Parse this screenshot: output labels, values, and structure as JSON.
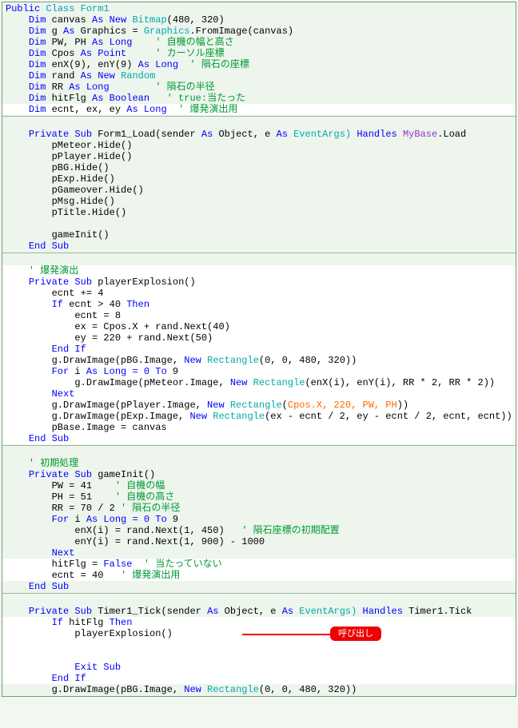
{
  "block1": {
    "l1_a": "Public",
    "l1_b": " Class ",
    "l1_c": "Form1",
    "l2_a": "    ",
    "l2_b": "Dim",
    "l2_c": " canvas ",
    "l2_d": "As",
    "l2_e": " New ",
    "l2_f": "Bitmap",
    "l2_g": "(480, 320)",
    "l3_a": "    ",
    "l3_b": "Dim",
    "l3_c": " g ",
    "l3_d": "As",
    "l3_e": " Graphics = ",
    "l3_f": "Graphics",
    "l3_g": ".FromImage(canvas)",
    "l4_a": "    ",
    "l4_b": "Dim",
    "l4_c": " PW, PH ",
    "l4_d": "As",
    "l4_e": " Long    ",
    "l4_f": "' 自機の幅と高さ",
    "l5_a": "    ",
    "l5_b": "Dim",
    "l5_c": " Cpos ",
    "l5_d": "As",
    "l5_e": " Point     ",
    "l5_f": "' カーソル座標",
    "l6_a": "    ",
    "l6_b": "Dim",
    "l6_c": " enX(9), enY(9) ",
    "l6_d": "As",
    "l6_e": " Long",
    "l6_f": "  ' 隕石の座標",
    "l7_a": "    ",
    "l7_b": "Dim",
    "l7_c": " rand ",
    "l7_d": "As",
    "l7_e": " New ",
    "l7_f": "Random",
    "l8_a": "    ",
    "l8_b": "Dim",
    "l8_c": " RR ",
    "l8_d": "As",
    "l8_e": " Long        ",
    "l8_f": "' 隕石の半径",
    "l9_a": "    ",
    "l9_b": "Dim",
    "l9_c": " hitFlg ",
    "l9_d": "As",
    "l9_e": " Boolean   ",
    "l9_f": "' true:当たった",
    "l10_a": "    ",
    "l10_b": "Dim",
    "l10_c": " ecnt, ex, ey ",
    "l10_d": "As",
    "l10_e": " Long  ",
    "l10_f": "' 爆発演出用"
  },
  "block2": {
    "l1_a": "    ",
    "l1_b": "Private",
    "l1_c": " Sub ",
    "l1_d": "Form1_Load(sender ",
    "l1_e": "As",
    "l1_f": " Object, e ",
    "l1_g": "As",
    "l1_h": " EventArgs) ",
    "l1_i": "Handles",
    "l1_j": " MyBase",
    "l1_k": ".Load",
    "l2": "        pMeteor.Hide()",
    "l3": "        pPlayer.Hide()",
    "l4": "        pBG.Hide()",
    "l5": "        pExp.Hide()",
    "l6": "        pGameover.Hide()",
    "l7": "        pMsg.Hide()",
    "l8": "        pTitle.Hide()",
    "l9": "",
    "l10": "        gameInit()",
    "l11_a": "    ",
    "l11_b": "End",
    "l11_c": " Sub"
  },
  "block3": {
    "l1_a": "    ",
    "l1_b": "' 爆発演出",
    "l2_a": "    ",
    "l2_b": "Private",
    "l2_c": " Sub ",
    "l2_d": "playerExplosion()",
    "l3": "        ecnt += 4",
    "l4_a": "        ",
    "l4_b": "If",
    "l4_c": " ecnt > 40 ",
    "l4_d": "Then",
    "l5": "            ecnt = 8",
    "l6": "            ex = Cpos.X + rand.Next(40)",
    "l7": "            ey = 220 + rand.Next(50)",
    "l8_a": "        ",
    "l8_b": "End",
    "l8_c": " If",
    "l9_a": "        g.DrawImage(pBG.Image, ",
    "l9_b": "New",
    "l9_c": " Rectangle",
    "l9_d": "(0, 0, 480, 320))",
    "l10_a": "        ",
    "l10_b": "For",
    "l10_c": " i ",
    "l10_d": "As",
    "l10_e": " Long = 0 ",
    "l10_f": "To",
    "l10_g": " 9",
    "l11_a": "            g.DrawImage(pMeteor.Image, ",
    "l11_b": "New",
    "l11_c": " Rectangle",
    "l11_d": "(enX(i), enY(i), RR * 2, RR * 2))",
    "l12_a": "        ",
    "l12_b": "Next",
    "l13_a": "        g.DrawImage(pPlayer.Image, ",
    "l13_b": "New",
    "l13_c": " Rectangle",
    "l13_d": "(",
    "l13_e": "Cpos.X, 220, PW, PH",
    "l13_f": "))",
    "l14_a": "        g.DrawImage(pExp.Image, ",
    "l14_b": "New",
    "l14_c": " Rectangle",
    "l14_d": "(ex - ecnt / 2, ey - ecnt / 2, ecnt, ecnt))",
    "l15": "        pBase.Image = canvas",
    "l16_a": "    ",
    "l16_b": "End",
    "l16_c": " Sub"
  },
  "block4": {
    "l1_a": "    ",
    "l1_b": "' 初期処理",
    "l2_a": "    ",
    "l2_b": "Private",
    "l2_c": " Sub ",
    "l2_d": "gameInit()",
    "l3_a": "        PW = 41    ",
    "l3_b": "' 自機の幅",
    "l4_a": "        PH = 51    ",
    "l4_b": "' 自機の高さ",
    "l5_a": "        RR = 70 / 2 ",
    "l5_b": "' 隕石の半径",
    "l6_a": "        ",
    "l6_b": "For",
    "l6_c": " i ",
    "l6_d": "As",
    "l6_e": " Long = 0 ",
    "l6_f": "To",
    "l6_g": " 9",
    "l7_a": "            enX(i) = rand.Next(1, 450)   ",
    "l7_b": "' 隕石座標の初期配置",
    "l8": "            enY(i) = rand.Next(1, 900) - 1000",
    "l9_a": "        ",
    "l9_b": "Next",
    "l10_a": "        hitFlg = ",
    "l10_b": "False",
    "l10_c": "  ' 当たっていない",
    "l11_a": "        ecnt = 40   ",
    "l11_b": "' 爆発演出用",
    "l12_a": "    ",
    "l12_b": "End",
    "l12_c": " Sub"
  },
  "block5": {
    "l1_a": "    ",
    "l1_b": "Private",
    "l1_c": " Sub ",
    "l1_d": "Timer1_Tick(sender ",
    "l1_e": "As",
    "l1_f": " Object, e ",
    "l1_g": "As",
    "l1_h": " EventArgs) ",
    "l1_i": "Handles",
    "l1_j": " Timer1.Tick",
    "l2_a": "        ",
    "l2_b": "If",
    "l2_c": " hitFlg ",
    "l2_d": "Then",
    "l3": "            playerExplosion()",
    "l4_a": "            ",
    "l4_b": "Exit",
    "l4_c": " Sub",
    "l5_a": "        ",
    "l5_b": "End",
    "l5_c": " If",
    "l6_a": "        g.DrawImage(pBG.Image, ",
    "l6_b": "New",
    "l6_c": " Rectangle",
    "l6_d": "(0, 0, 480, 320))"
  },
  "callout": "呼び出し"
}
